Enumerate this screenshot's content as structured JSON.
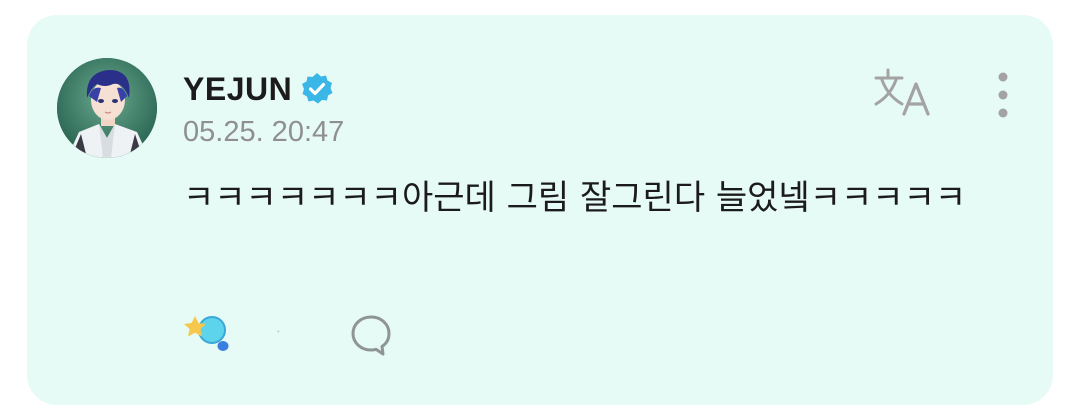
{
  "post": {
    "author": "YEJUN",
    "verified_icon": "verified-badge-icon",
    "timestamp": "05.25. 20:47",
    "message": "ㅋㅋㅋㅋㅋㅋㅋ아근데 그림 잘그린다 늘었넼ㅋㅋㅋㅋㅋ",
    "reaction_count": "·"
  },
  "icons": {
    "translate": "translate-icon",
    "more": "more-vertical-icon",
    "reaction": "reaction-star-bulb-icon",
    "comment": "comment-bubble-icon"
  },
  "colors": {
    "card_background": "#e7fbf6",
    "verified": "#3ab7e6",
    "text_primary": "#1b1b1b",
    "text_secondary": "#8f8f8f",
    "icon_gray": "#a3a3a3"
  }
}
